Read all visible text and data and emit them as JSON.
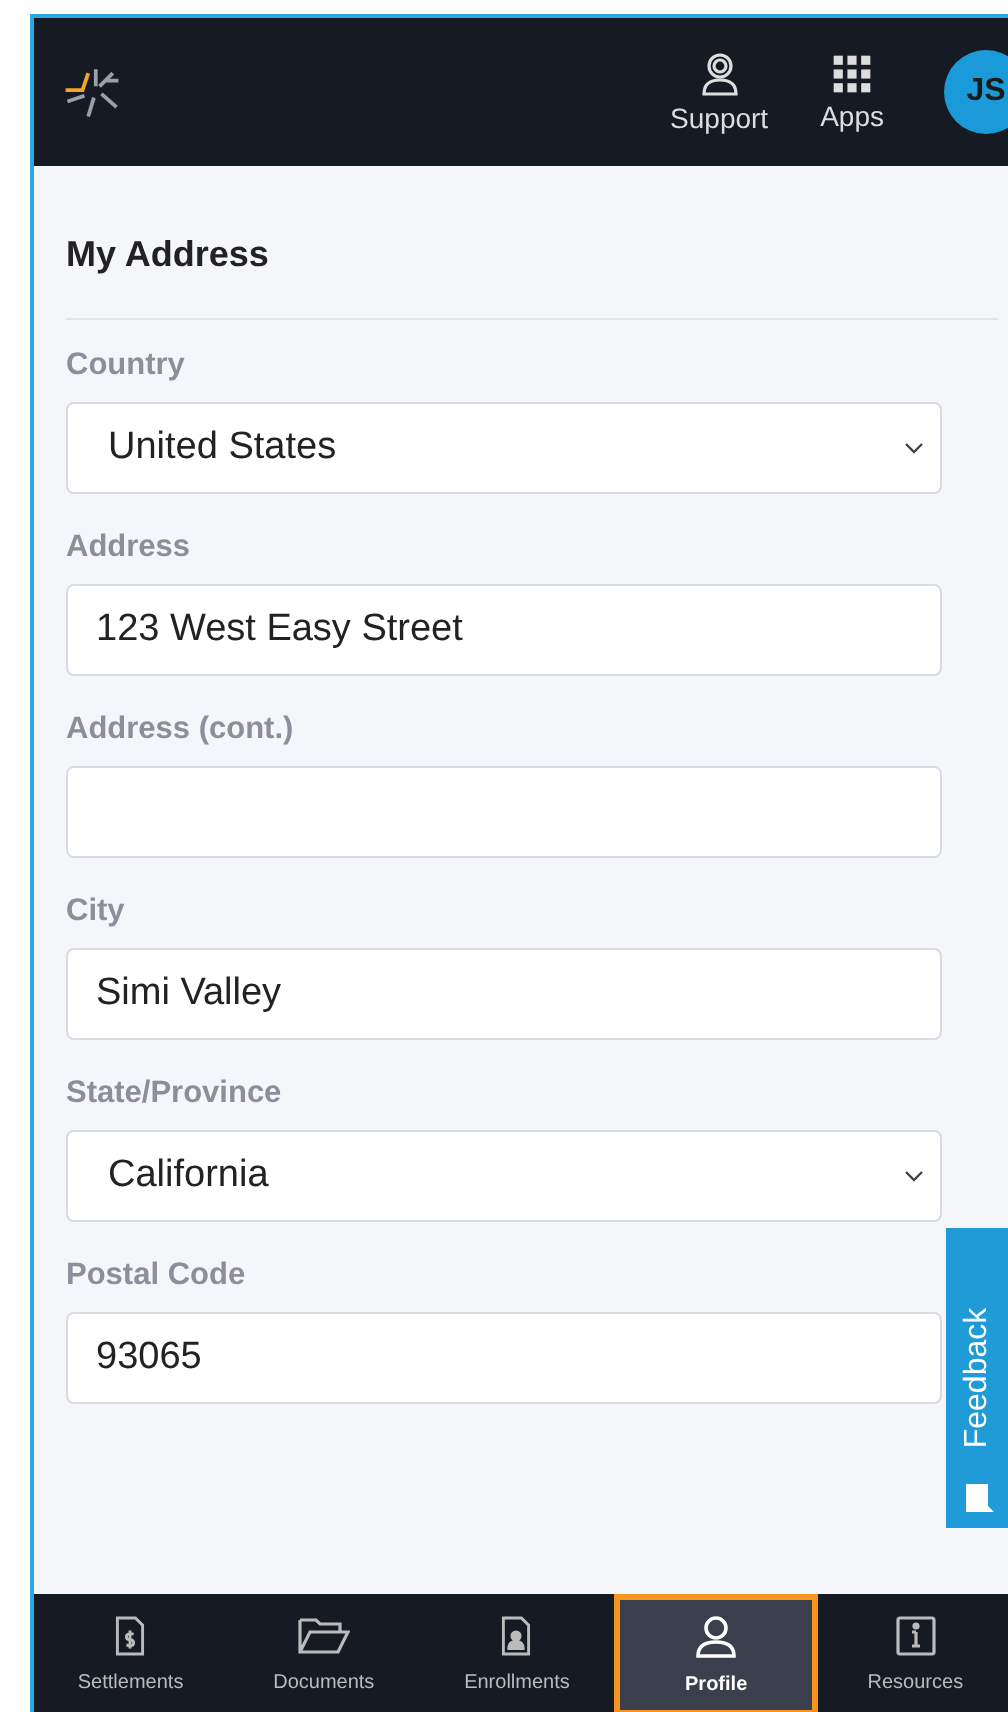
{
  "header": {
    "actions": [
      {
        "kind": "support",
        "label": "Support"
      },
      {
        "kind": "apps",
        "label": "Apps"
      }
    ],
    "avatar": "JS"
  },
  "section": {
    "title": "My Address"
  },
  "fields": [
    {
      "label": "Country",
      "kind": "select",
      "value": "United States"
    },
    {
      "label": "Address",
      "kind": "text",
      "value": "123 West Easy Street"
    },
    {
      "label": "Address (cont.)",
      "kind": "text"
    },
    {
      "label": "City",
      "kind": "text",
      "value": "Simi Valley"
    },
    {
      "label": "State/Province",
      "kind": "select",
      "value": "California"
    },
    {
      "label": "Postal Code",
      "kind": "text",
      "value": "93065"
    }
  ],
  "feedback_tab": {
    "label": "Feedback"
  },
  "bottom_nav": [
    {
      "kind": "settlements",
      "label": "Settlements",
      "selected": false
    },
    {
      "kind": "documents",
      "label": "Documents",
      "selected": false
    },
    {
      "kind": "enrollments",
      "label": "Enrollments",
      "selected": false
    },
    {
      "kind": "profile",
      "label": "Profile",
      "selected": true
    },
    {
      "kind": "resources",
      "label": "Resources",
      "selected": false
    }
  ]
}
